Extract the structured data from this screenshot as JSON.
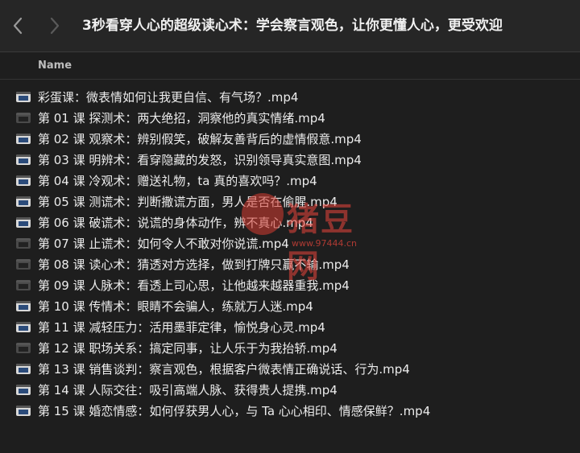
{
  "window": {
    "title": "3秒看穿人心的超级读心术：学会察言观色，让你更懂人心，更受欢迎"
  },
  "columns": {
    "name": "Name"
  },
  "files": [
    {
      "name": "彩蛋课：微表情如何让我更自信、有气场？.mp4",
      "icon": "video-file-icon"
    },
    {
      "name": "第 01 课 探测术：两大绝招，洞察他的真实情绪.mp4",
      "icon": "video-file-icon"
    },
    {
      "name": "第 02 课 观察术：辨别假笑，破解友善背后的虚情假意.mp4",
      "icon": "video-file-icon"
    },
    {
      "name": "第 03 课 明辨术：看穿隐藏的发怒，识别领导真实意图.mp4",
      "icon": "video-file-icon"
    },
    {
      "name": "第 04 课 冷观术：赠送礼物，ta 真的喜欢吗？.mp4",
      "icon": "video-file-icon"
    },
    {
      "name": "第 05 课 测谎术：判断撒谎方面，男人是否在偷腥.mp4",
      "icon": "video-file-icon"
    },
    {
      "name": "第 06 课 破谎术：说谎的身体动作，辨不真心.mp4",
      "icon": "video-file-icon"
    },
    {
      "name": "第 07 课 止谎术：如何令人不敢对你说谎.mp4",
      "icon": "video-file-icon"
    },
    {
      "name": "第 08 课 读心术：猜透对方选择，做到打牌只赢不输.mp4",
      "icon": "video-file-icon"
    },
    {
      "name": "第 09 课 人脉术：看透上司心思，让他越来越器重我.mp4",
      "icon": "video-file-icon"
    },
    {
      "name": "第 10 课 传情术：眼睛不会骗人，练就万人迷.mp4",
      "icon": "video-file-icon"
    },
    {
      "name": "第 11 课 减轻压力：活用墨菲定律，愉悦身心灵.mp4",
      "icon": "video-file-icon"
    },
    {
      "name": "第 12 课 职场关系：搞定同事，让人乐于为我抬轿.mp4",
      "icon": "video-file-icon"
    },
    {
      "name": "第 13 课 销售谈判：察言观色，根据客户微表情正确说话、行为.mp4",
      "icon": "video-file-icon"
    },
    {
      "name": "第 14 课 人际交往：吸引高端人脉、获得贵人提携.mp4",
      "icon": "video-file-icon"
    },
    {
      "name": "第 15 课 婚恋情感：如何俘获男人心，与 Ta 心心相印、情感保鲜？.mp4",
      "icon": "video-file-icon"
    }
  ],
  "watermark": {
    "text": "猪豆网",
    "url": "www.97444.cn"
  },
  "colors": {
    "background": "#1e1e1e",
    "toolbar": "#262626",
    "text": "#ececec",
    "watermark": "#eb463c"
  }
}
